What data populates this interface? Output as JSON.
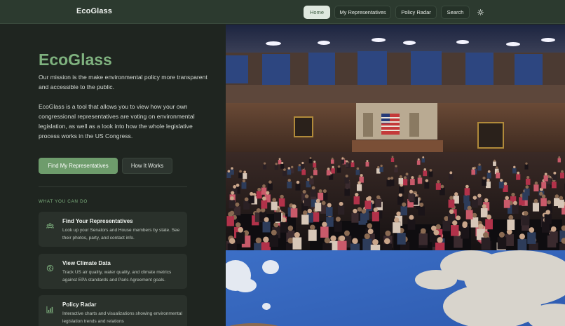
{
  "header": {
    "brand": "EcoGlass",
    "nav": [
      {
        "label": "Home",
        "active": true
      },
      {
        "label": "My Representatives",
        "active": false
      },
      {
        "label": "Policy Radar",
        "active": false
      },
      {
        "label": "Search",
        "active": false
      }
    ],
    "theme_toggle_icon": "sun-icon"
  },
  "hero": {
    "title": "EcoGlass",
    "mission": "Our mission is the make environmental policy more transparent and accessible to the public.",
    "description": "EcoGlass is a tool that allows you to view how your own congressional representatives are voting on environmental legislation, as well as a look into how the whole legislative process works in the US Congress.",
    "primary_button": "Find My Representatives",
    "secondary_button": "How It Works"
  },
  "features": {
    "section_label": "WHAT YOU CAN DO",
    "items": [
      {
        "title": "Find Your Representatives",
        "description": "Look up your Senators and House members by state. See their photos, party, and contact info.",
        "icon": "people-icon"
      },
      {
        "title": "View Climate Data",
        "description": "Track US air quality, water quality, and climate metrics against EPA standards and Paris Agreement goals.",
        "icon": "globe-icon"
      },
      {
        "title": "Policy Radar",
        "description": "Interactive charts and visualizations showing environmental legislation trends and relations",
        "icon": "bar-chart-icon"
      }
    ]
  },
  "colors": {
    "accent": "#7fb27f",
    "primary_button": "#6e9c6c",
    "nav_bg": "#2c3a2f",
    "page_bg": "#1f2520",
    "card_bg": "#2a312b"
  },
  "images": {
    "top": "house-chamber-photo",
    "bottom": "sky-clouds-photo"
  }
}
